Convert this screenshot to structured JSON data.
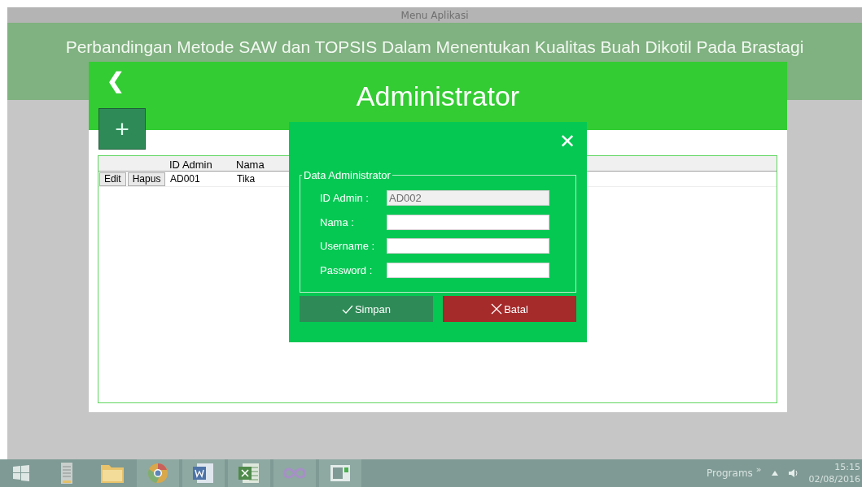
{
  "window": {
    "title": "Menu Aplikasi"
  },
  "app_title": "Perbandingan Metode SAW dan TOPSIS Dalam Menentukan Kualitas Buah Dikotil Pada Brastagi",
  "panel": {
    "back": "❮",
    "title": "Administrator",
    "add": "+"
  },
  "table": {
    "columns": [
      "ID Admin",
      "Nama"
    ],
    "rows": [
      {
        "actions": [
          "Edit",
          "Hapus"
        ],
        "cells": [
          "AD001",
          "Tika"
        ]
      }
    ]
  },
  "dialog": {
    "close": "✕",
    "group": "Data Administrator",
    "fields": [
      {
        "label": "ID Admin :",
        "value": "AD002",
        "disabled": true
      },
      {
        "label": "Nama :",
        "disabled": false
      },
      {
        "label": "Username :",
        "disabled": false
      },
      {
        "label": "Password :",
        "disabled": false
      }
    ],
    "buttons": [
      {
        "kind": "save",
        "label": "Simpan"
      },
      {
        "kind": "cancel",
        "label": "Batal"
      }
    ]
  },
  "taskbar": {
    "tray_label": "Programs",
    "chevron": "»",
    "time": "15:15",
    "date": "02/08/2016"
  }
}
